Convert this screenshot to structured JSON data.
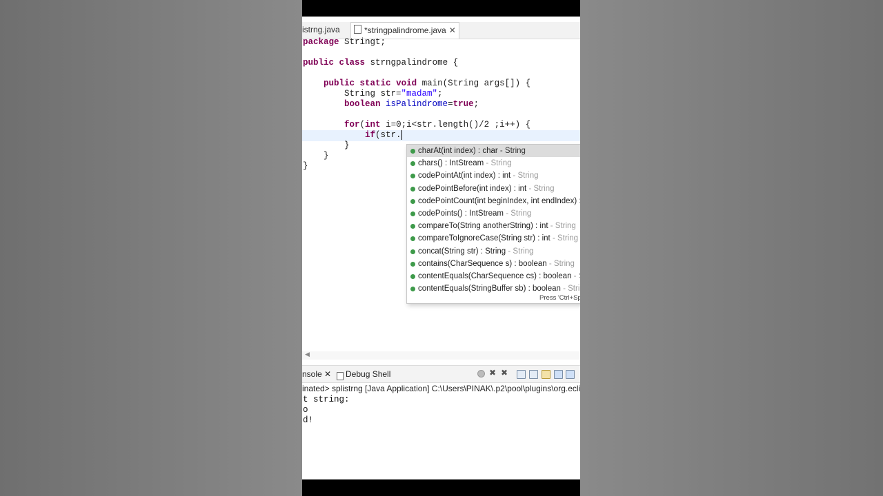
{
  "editor_tabs": [
    {
      "label": "istrng.java",
      "active": false
    },
    {
      "label": "*stringpalindrome.java",
      "active": true
    }
  ],
  "tab_close": "✕",
  "code": {
    "line1": {
      "kw": "package",
      "rest": " Stringt;"
    },
    "line2": {
      "kw1": "public",
      "kw2": "class",
      "rest": " strngpalindrome {"
    },
    "line3": {
      "kw1": "public",
      "kw2": "static",
      "kw3": "void",
      "rest": " main(String args[]) {"
    },
    "line4": {
      "a": "String str=",
      "str": "\"madam\"",
      "b": ";"
    },
    "line5": {
      "kw": "boolean",
      "fld": " isPalindrome",
      "b": "=",
      "kw2": "true",
      "c": ";"
    },
    "line6": {
      "kw": "for",
      "a": "(",
      "kw2": "int",
      "b": " i=0;i<str.length()/2 ;i++) {"
    },
    "line7": {
      "kw": "if",
      "a": "(str."
    },
    "close1": "}",
    "close2": "}",
    "close3": "}"
  },
  "autocomplete": {
    "items": [
      {
        "sig": "charAt(int index) : char",
        "owner": " - String",
        "selected": true
      },
      {
        "sig": "chars() : IntStream",
        "owner": " - String",
        "selected": false
      },
      {
        "sig": "codePointAt(int index) : int",
        "owner": " - String",
        "selected": false
      },
      {
        "sig": "codePointBefore(int index) : int",
        "owner": " - String",
        "selected": false
      },
      {
        "sig": "codePointCount(int beginIndex, int endIndex) :",
        "owner": "",
        "selected": false
      },
      {
        "sig": "codePoints() : IntStream",
        "owner": " - String",
        "selected": false
      },
      {
        "sig": "compareTo(String anotherString) : int",
        "owner": " - String",
        "selected": false
      },
      {
        "sig": "compareToIgnoreCase(String str) : int",
        "owner": " - String",
        "selected": false
      },
      {
        "sig": "concat(String str) : String",
        "owner": " - String",
        "selected": false
      },
      {
        "sig": "contains(CharSequence s) : boolean",
        "owner": " - String",
        "selected": false
      },
      {
        "sig": "contentEquals(CharSequence cs) : boolean",
        "owner": " - Str",
        "selected": false
      },
      {
        "sig": "contentEquals(StringBuffer sb) : boolean",
        "owner": " - String",
        "selected": false
      }
    ],
    "hint": "Press 'Ctrl+Spa"
  },
  "console": {
    "tab_console": "nsole",
    "tab_close": "✕",
    "tab_debug": "Debug Shell",
    "description": "inated> splistrng [Java Application] C:\\Users\\PINAK\\.p2\\pool\\plugins\\org.eclipse",
    "output": [
      "t string:",
      "o",
      "d!"
    ]
  }
}
